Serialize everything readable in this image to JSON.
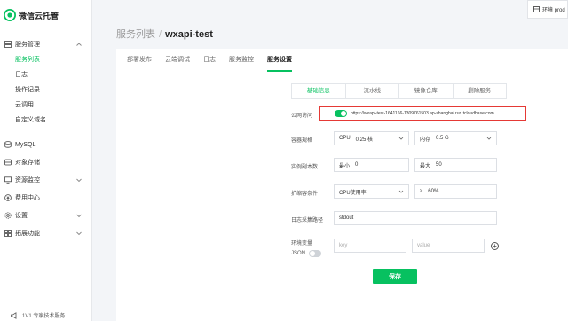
{
  "brand": {
    "name": "微信云托管"
  },
  "sidebar": {
    "groups": [
      {
        "label": "服务管理",
        "icon": "server-icon",
        "expanded": true,
        "items": [
          {
            "label": "服务列表",
            "active": true
          },
          {
            "label": "日志"
          },
          {
            "label": "操作记录"
          },
          {
            "label": "云调用"
          },
          {
            "label": "自定义域名"
          }
        ]
      },
      {
        "label": "MySQL",
        "icon": "database-icon"
      },
      {
        "label": "对象存储",
        "icon": "storage-icon"
      },
      {
        "label": "资源监控",
        "icon": "monitor-icon"
      },
      {
        "label": "费用中心",
        "icon": "billing-icon"
      },
      {
        "label": "设置",
        "icon": "gear-icon"
      },
      {
        "label": "拓展功能",
        "icon": "extension-icon"
      }
    ],
    "footer": "1V1 专家技术服务"
  },
  "env": {
    "label": "环境 prod"
  },
  "header": {
    "breadcrumb_parent": "服务列表",
    "separator": "/",
    "service_name": "wxapi-test"
  },
  "tabs": [
    {
      "label": "部署发布"
    },
    {
      "label": "云端调试"
    },
    {
      "label": "日志"
    },
    {
      "label": "服务监控"
    },
    {
      "label": "服务设置",
      "active": true
    }
  ],
  "subtabs": [
    {
      "label": "基础信息",
      "active": true
    },
    {
      "label": "流水线"
    },
    {
      "label": "镜像仓库"
    },
    {
      "label": "删除服务"
    }
  ],
  "form": {
    "public_access": {
      "label": "公网访问",
      "enabled": true,
      "url": "https://wxapi-test-1641166-1309761503.ap-shanghai.run.tcloudbase.com"
    },
    "spec": {
      "label": "容器规格",
      "cpu_prefix": "CPU",
      "cpu_value": "0.25 核",
      "mem_prefix": "内存",
      "mem_value": "0.5 G"
    },
    "replicas": {
      "label": "实例副本数",
      "min_prefix": "最小",
      "min_value": "0",
      "max_prefix": "最大",
      "max_value": "50"
    },
    "scaling": {
      "label": "扩缩容条件",
      "condition": "CPU使用率",
      "op": "≥",
      "threshold": "60%"
    },
    "log_path": {
      "label": "日志采集路径",
      "value": "stdout"
    },
    "env_vars": {
      "label": "环境变量",
      "json_label": "JSON",
      "json_enabled": false,
      "key_placeholder": "key",
      "value_placeholder": "value",
      "add_symbol": "+"
    },
    "save_label": "保存"
  },
  "colors": {
    "accent": "#07c160",
    "highlight": "#e53935"
  }
}
